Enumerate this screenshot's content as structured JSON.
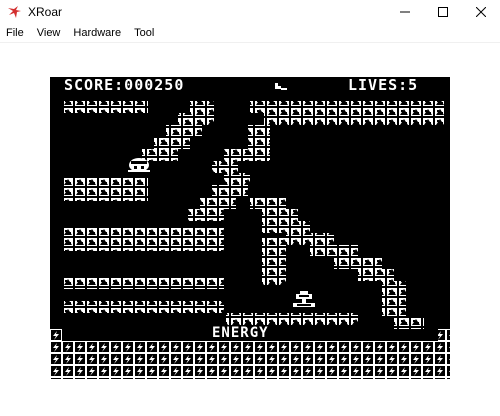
{
  "window": {
    "title": "XRoar",
    "controls": {
      "minimize": "minimize",
      "maximize": "maximize",
      "close": "close"
    }
  },
  "menu": {
    "items": [
      {
        "label": "File"
      },
      {
        "label": "View"
      },
      {
        "label": "Hardware"
      },
      {
        "label": "Tool"
      }
    ]
  },
  "game": {
    "score_label": "SCORE:000250",
    "lives_label": "LIVES:5",
    "energy_label": "ENERGY",
    "colors": {
      "background": "#000000",
      "foreground": "#ffffff",
      "accent": "#d32f2f"
    }
  }
}
